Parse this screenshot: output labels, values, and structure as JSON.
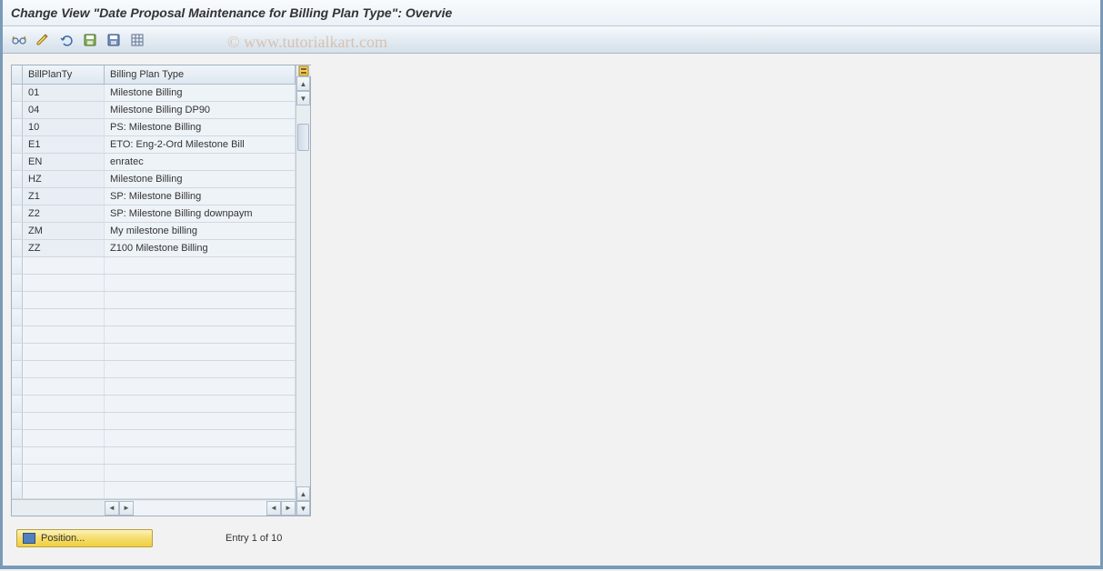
{
  "window": {
    "title": "Change View \"Date Proposal Maintenance for Billing Plan Type\": Overvie"
  },
  "toolbar": {
    "icons": [
      "glasses",
      "pencil",
      "undo",
      "save-green",
      "save-blue",
      "table-settings"
    ]
  },
  "table": {
    "headers": {
      "col1": "BillPlanTy",
      "col2": "Billing Plan Type"
    },
    "rows": [
      {
        "code": "01",
        "desc": "Milestone Billing"
      },
      {
        "code": "04",
        "desc": "Milestone Billing DP90"
      },
      {
        "code": "10",
        "desc": "PS: Milestone Billing"
      },
      {
        "code": "E1",
        "desc": "ETO: Eng-2-Ord Milestone Bill"
      },
      {
        "code": "EN",
        "desc": "enratec"
      },
      {
        "code": "HZ",
        "desc": "Milestone Billing"
      },
      {
        "code": "Z1",
        "desc": "SP: Milestone Billing"
      },
      {
        "code": "Z2",
        "desc": "SP: Milestone Billing downpaym"
      },
      {
        "code": "ZM",
        "desc": "My milestone billing"
      },
      {
        "code": "ZZ",
        "desc": "Z100 Milestone Billing"
      }
    ],
    "emptyRows": 14
  },
  "footer": {
    "positionLabel": "Position...",
    "entryText": "Entry 1 of 10"
  },
  "watermark": "© www.tutorialkart.com"
}
